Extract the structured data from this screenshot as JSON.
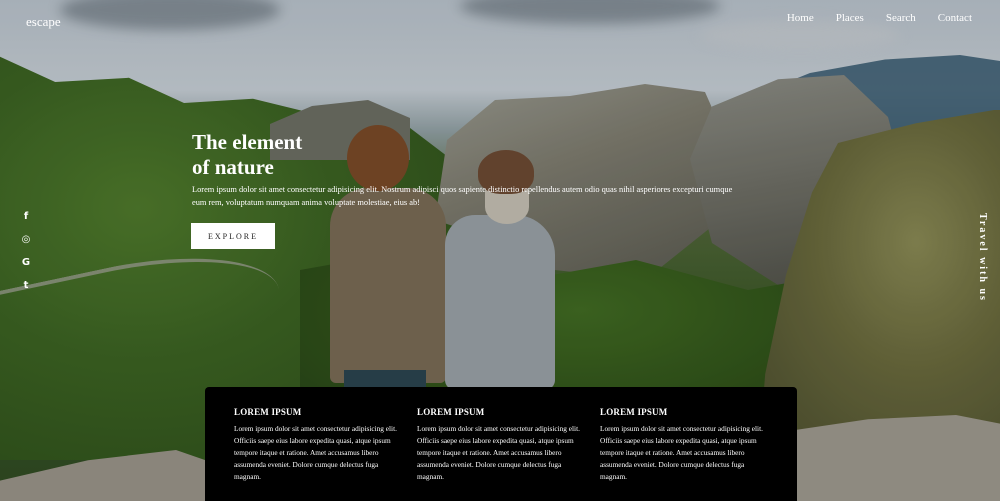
{
  "header": {
    "logo": "escape",
    "nav": [
      "Home",
      "Places",
      "Search",
      "Contact"
    ]
  },
  "hero": {
    "title_line1": "The element",
    "title_line2": "of nature",
    "body": "Lorem ipsum dolor sit amet consectetur adipisicing elit. Nostrum adipisci quos sapiente distinctio repellendus autem odio quas nihil asperiores excepturi cumque eum rem, voluptatum numquam anima voluptate molestiae, eius ab!",
    "button_label": "EXPLORE",
    "side_tagline": "Travel with us"
  },
  "social": {
    "icons": [
      "facebook-icon",
      "instagram-icon",
      "google-icon",
      "twitter-icon"
    ],
    "glyphs": [
      "f",
      "◎",
      "G",
      "t"
    ]
  },
  "features": [
    {
      "title": "LOREM IPSUM",
      "text": "Lorem ipsum dolor sit amet consectetur adipisicing elit. Officiis saepe eius labore expedita quasi, atque ipsum tempore itaque et ratione. Amet accusamus libero assumenda eveniet. Dolore cumque delectus fuga magnam."
    },
    {
      "title": "LOREM IPSUM",
      "text": "Lorem ipsum dolor sit amet consectetur adipisicing elit. Officiis saepe eius labore expedita quasi, atque ipsum tempore itaque et ratione. Amet accusamus libero assumenda eveniet. Dolore cumque delectus fuga magnam."
    },
    {
      "title": "LOREM IPSUM",
      "text": "Lorem ipsum dolor sit amet consectetur adipisicing elit. Officiis saepe eius labore expedita quasi, atque ipsum tempore itaque et ratione. Amet accusamus libero assumenda eveniet. Dolore cumque delectus fuga magnam."
    }
  ],
  "colors": {
    "panel": "#000000",
    "text": "#ffffff",
    "button_bg": "#ffffff"
  }
}
